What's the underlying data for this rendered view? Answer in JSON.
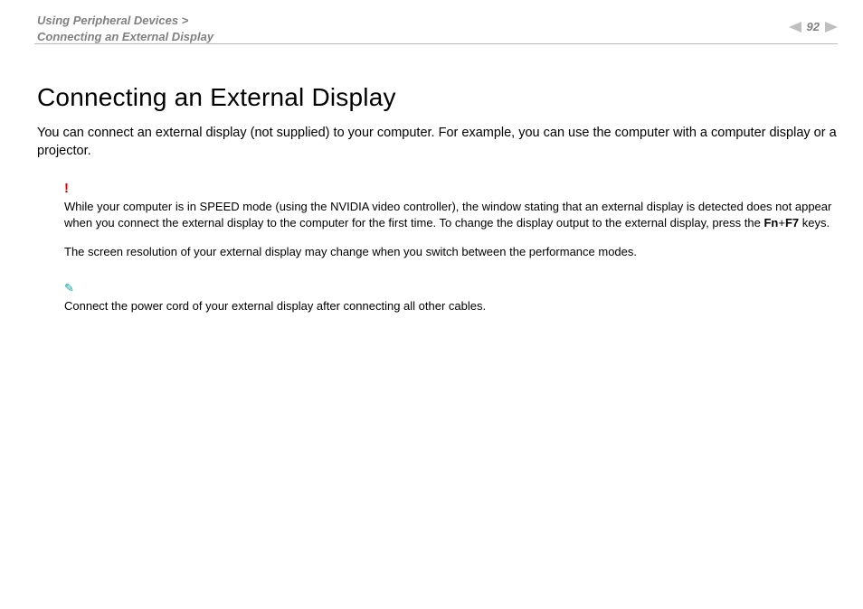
{
  "header": {
    "breadcrumb_line1": "Using Peripheral Devices >",
    "breadcrumb_line2": "Connecting an External Display",
    "page_number": "92"
  },
  "body": {
    "title": "Connecting an External Display",
    "intro": "You can connect an external display (not supplied) to your computer. For example, you can use the computer with a computer display or a projector.",
    "bang": "!",
    "warn1_a": "While your computer is in SPEED mode (using the NVIDIA video controller), the window stating that an external display is detected does not appear when you connect the external display to the computer for the first time. To change the display output to the external display, press the ",
    "warn1_b": "Fn",
    "warn1_plus": "+",
    "warn1_c": "F7",
    "warn1_d": " keys.",
    "warn2": "The screen resolution of your external display may change when you switch between the performance modes.",
    "pencil": "✎",
    "tip": "Connect the power cord of your external display after connecting all other cables."
  }
}
